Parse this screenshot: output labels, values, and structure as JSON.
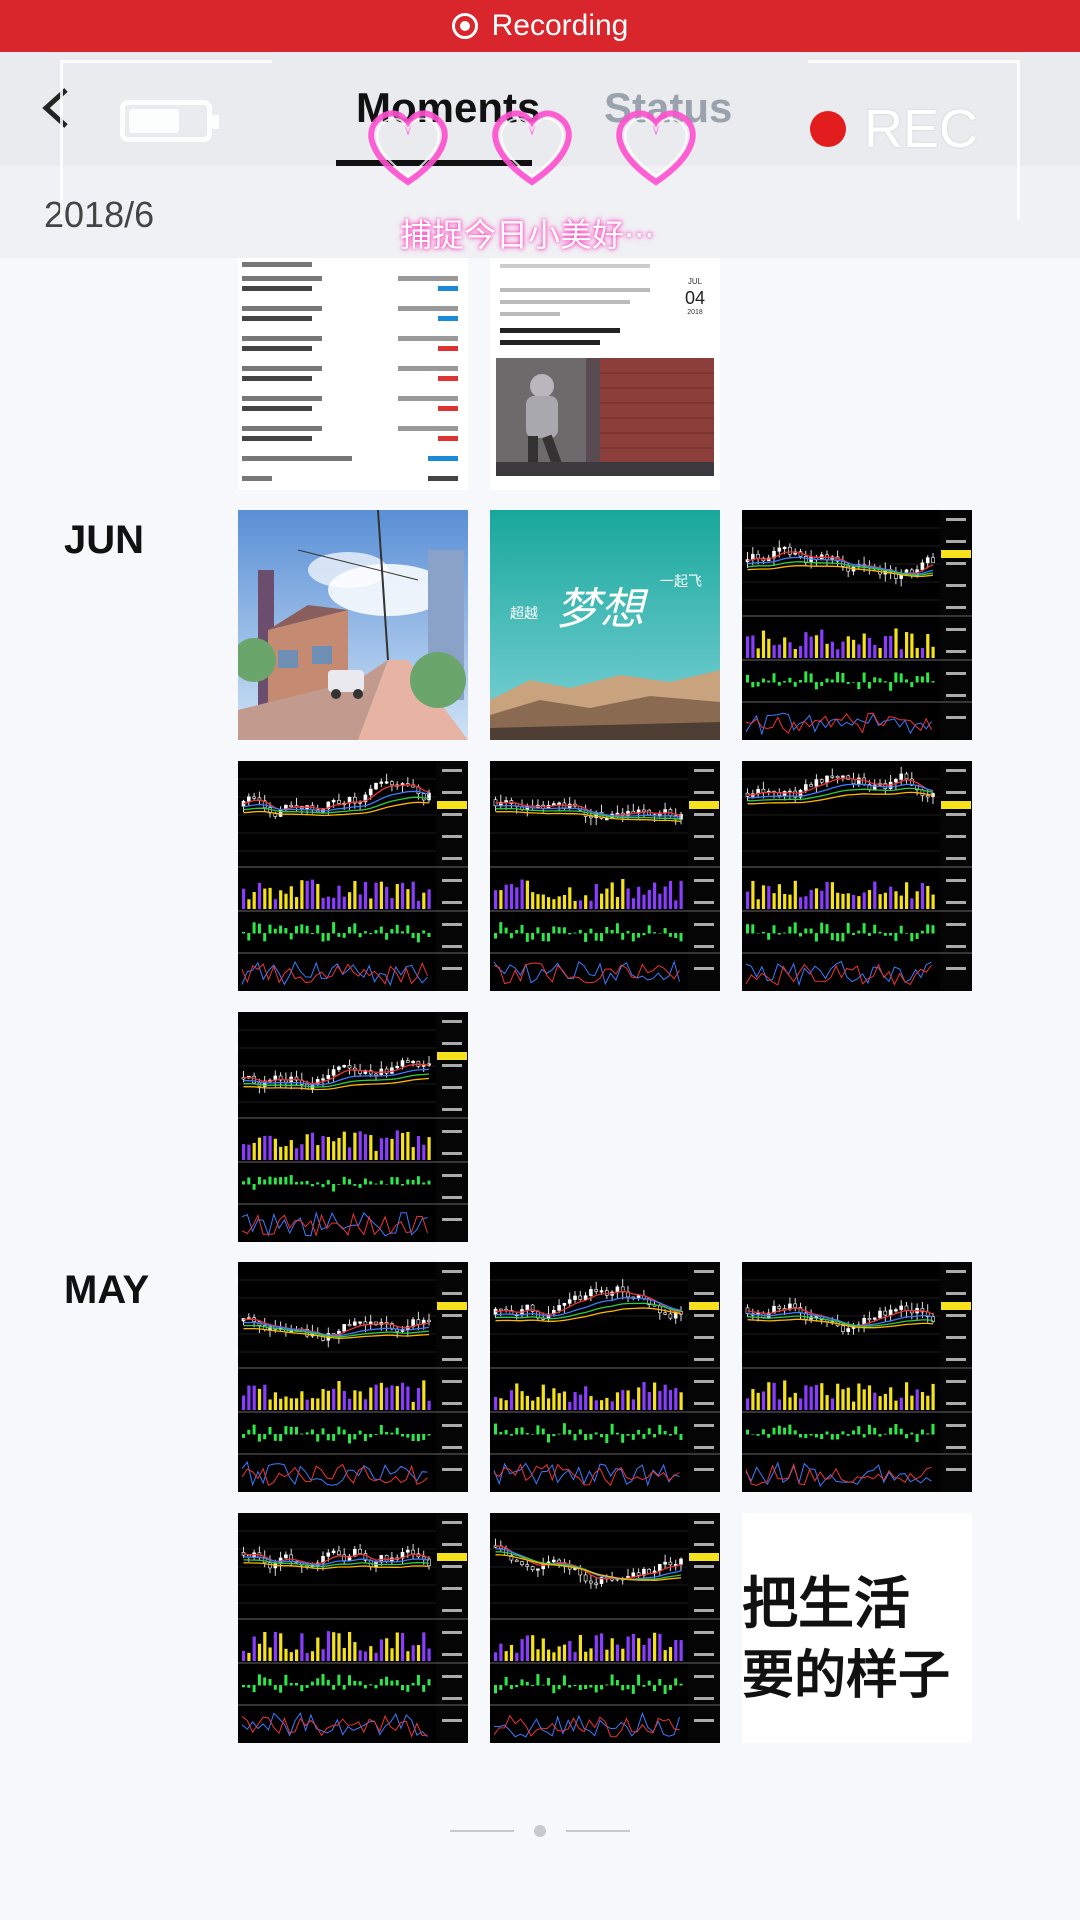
{
  "recording_bar": {
    "label": "Recording"
  },
  "nav": {
    "tabs": [
      {
        "label": "Moments"
      },
      {
        "label": "Status"
      }
    ],
    "rec_label": "REC"
  },
  "header": {
    "date": "2018/6"
  },
  "overlay": {
    "caption": "捕捉今日小美好···"
  },
  "months": [
    {
      "label": "JUN"
    },
    {
      "label": "MAY"
    }
  ],
  "thumbnails": {
    "dream_text": "梦想",
    "dream_left": "超越",
    "dream_right": "一起飞",
    "life_text_top": "把生活",
    "life_text_bottom": "要的样子",
    "calendar_month": "JUL",
    "calendar_day": "04",
    "calendar_year": "2018"
  },
  "colors": {
    "recording_red": "#d9262c",
    "nav_bg": "#eaebee",
    "rec_dot": "#e31d1d"
  }
}
